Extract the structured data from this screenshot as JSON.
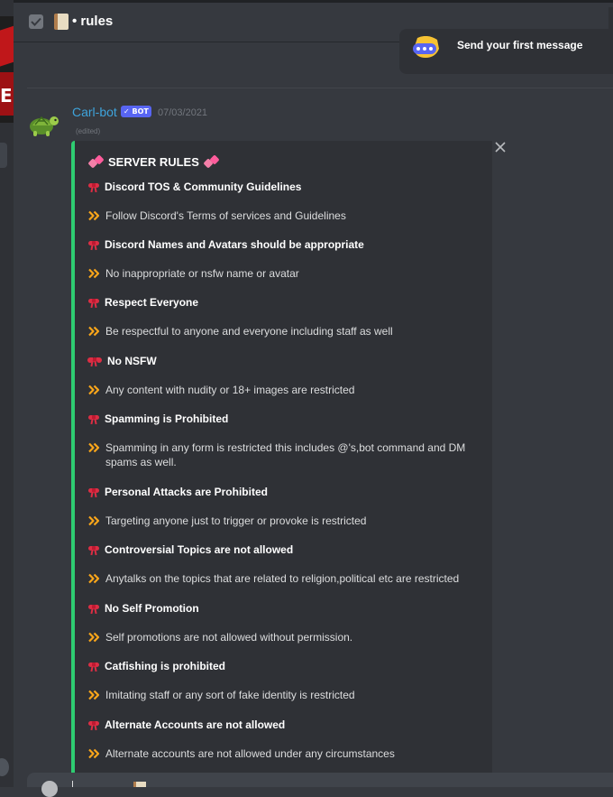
{
  "header": {
    "channel_name": "• rules"
  },
  "welcome": {
    "label": "Send your first message"
  },
  "message": {
    "author": "Carl-bot",
    "badge": "✓ BOT",
    "timestamp": "07/03/2021",
    "edited": "(edited)"
  },
  "embed": {
    "title": "SERVER RULES",
    "accent_color": "#2ecc71",
    "rules": [
      {
        "heading": "Discord TOS & Community Guidelines",
        "description": "Follow Discord's Terms of services and Guidelines"
      },
      {
        "heading": "Discord Names and Avatars should be appropriate",
        "description": "No inappropriate or nsfw name or avatar"
      },
      {
        "heading": "Respect Everyone",
        "description": "Be respectful to anyone and everyone including staff as well"
      },
      {
        "heading": "No NSFW",
        "description": "Any content with nudity or 18+ images are restricted"
      },
      {
        "heading": "Spamming is Prohibited",
        "description": "Spamming in any form is restricted this includes @'s,bot command and DM spams as well."
      },
      {
        "heading": "Personal Attacks are Prohibited",
        "description": "Targeting anyone just to trigger or provoke is restricted"
      },
      {
        "heading": "Controversial Topics are not allowed",
        "description": "Anytalks on the topics that are related to religion,political etc are restricted"
      },
      {
        "heading": "No Self Promotion",
        "description": "Self promotions are not allowed without permission."
      },
      {
        "heading": "Catfishing is prohibited",
        "description": "Imitating staff or any sort of fake identity is restricted"
      },
      {
        "heading": "Alternate Accounts are not allowed",
        "description": "Alternate accounts are not allowed under any circumstances"
      }
    ]
  },
  "icons": {
    "header_checkbox": "checkbox-icon",
    "header_channel": "scroll-icon",
    "welcome": "wumpus-chat-icon",
    "avatar": "turtle-avatar",
    "close": "close-icon",
    "heading_bullet": "ribbon-bow-icon",
    "description_bullet": "double-chevron-right-icon",
    "title_decoration": "two-hearts-icon"
  },
  "colors": {
    "background": "#36393f",
    "author": "#3ea4dc",
    "badge": "#5865f2",
    "chevrons": "#faa61a",
    "bow": "#dd2e44"
  }
}
